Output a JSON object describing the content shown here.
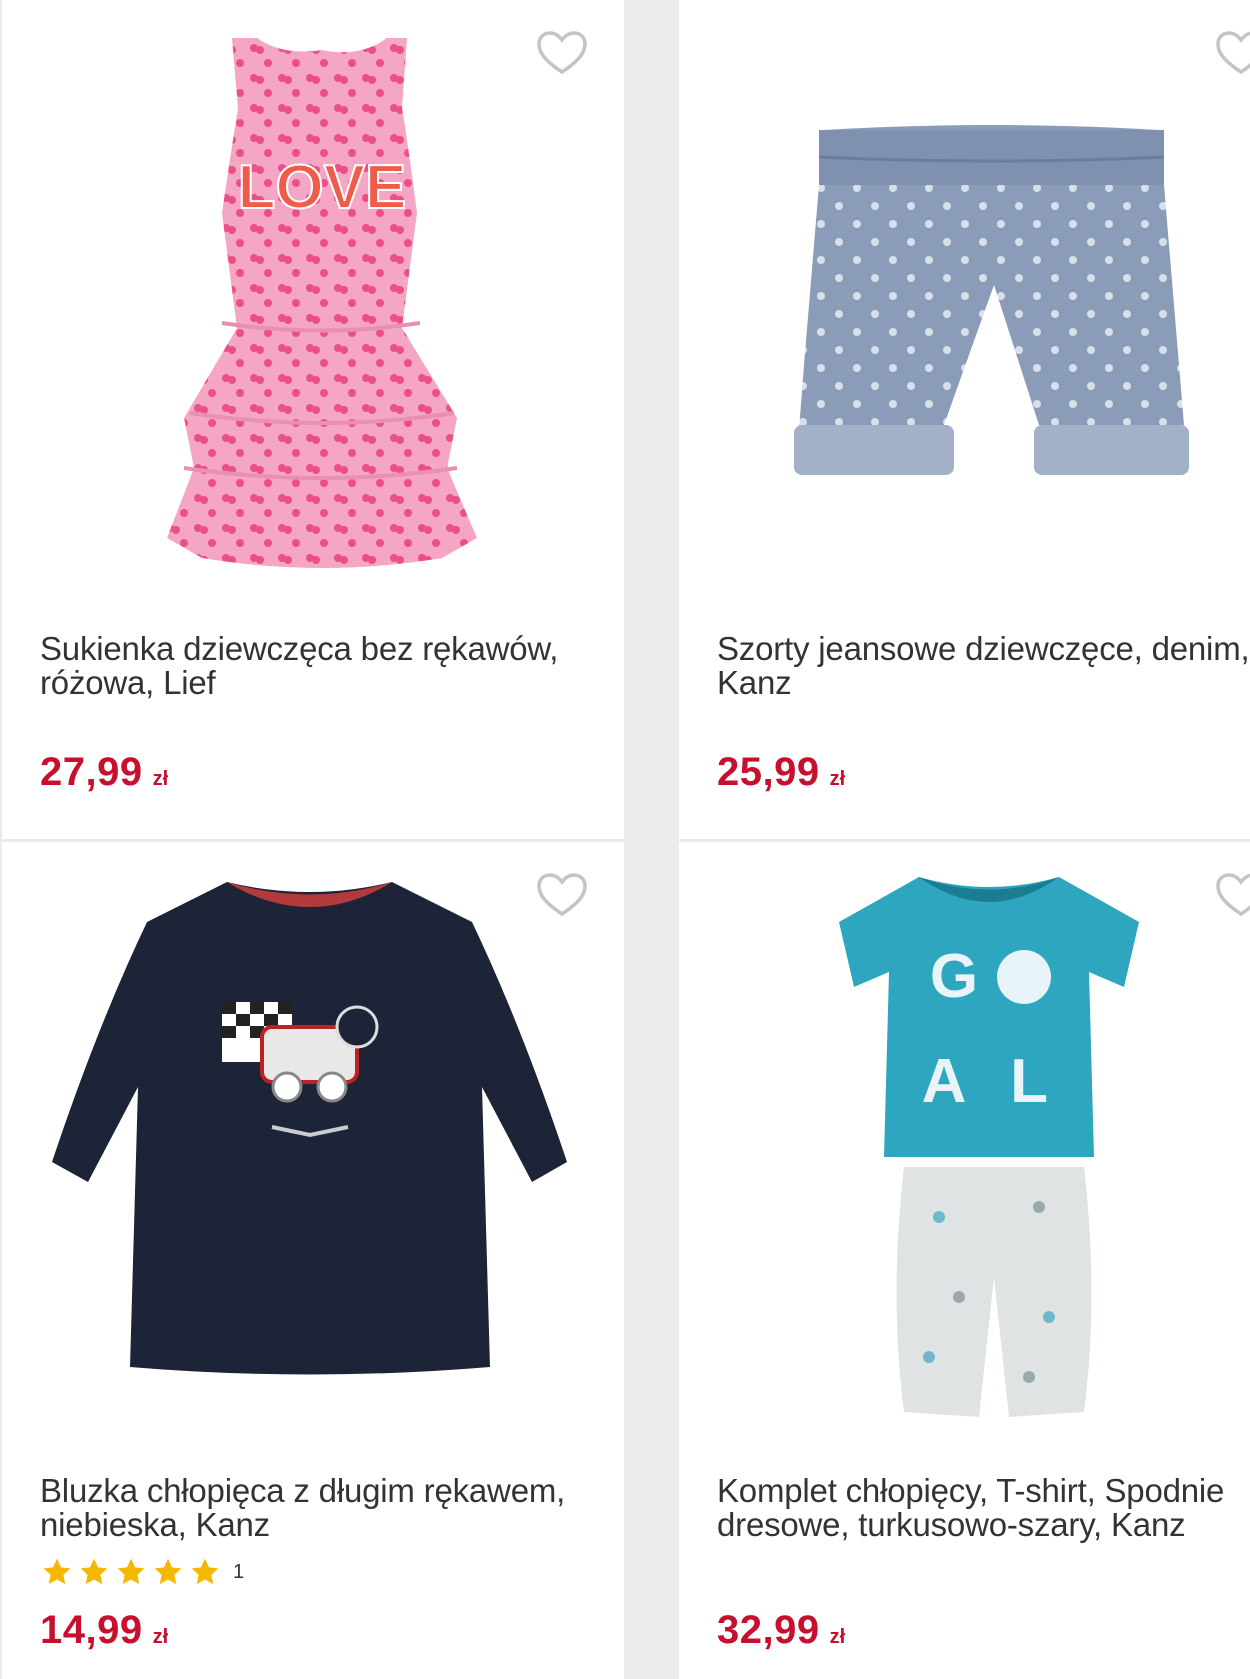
{
  "products": [
    {
      "title": "Sukienka dziewczęca bez rękawów, różowa, Lief",
      "price": "27,99",
      "currency": "zł",
      "image_icon": "pink-dress-image",
      "image_text": "LOVE"
    },
    {
      "title": "Szorty jeansowe dziewczęce, denim, Kanz",
      "price": "25,99",
      "currency": "zł",
      "image_icon": "denim-shorts-image"
    },
    {
      "title": "Bluzka chłopięca z długim rękawem, niebieska, Kanz",
      "price": "14,99",
      "currency": "zł",
      "image_icon": "navy-longsleeve-image",
      "rating": {
        "stars": 5,
        "count": "1"
      }
    },
    {
      "title": "Komplet chłopięcy, T-shirt, Spodnie dresowe, turkusowo-szary, Kanz",
      "price": "32,99",
      "currency": "zł",
      "image_icon": "turquoise-tshirt-pants-set-image",
      "image_text_top": "G",
      "image_text_bottom_left": "A",
      "image_text_bottom_right": "L"
    }
  ],
  "colors": {
    "price": "#c8102e",
    "star": "#f5b800",
    "heart": "#c4c4c4",
    "background": "#ebebeb"
  }
}
